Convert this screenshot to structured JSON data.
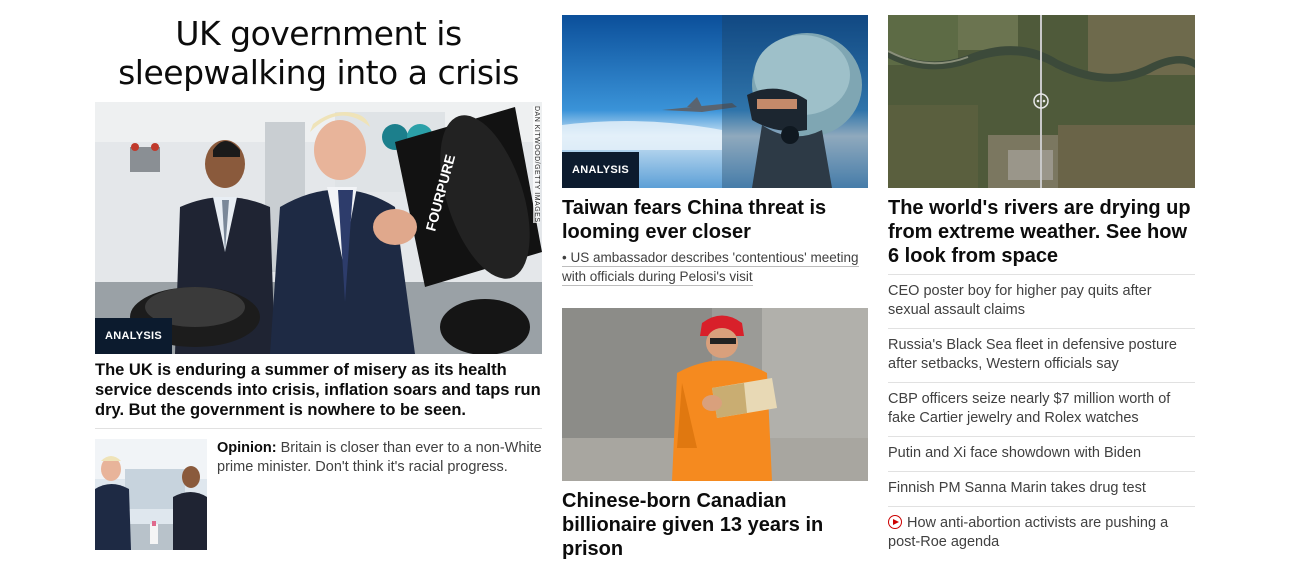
{
  "lead": {
    "headline": "UK government is sleepwalking into a crisis",
    "badge": "ANALYSIS",
    "photo_credit": "DAN KITWOOD/GETTY IMAGES",
    "summary": "The UK is enduring a summer of misery as its health service descends into crisis, inflation soars and taps run dry. But the government is nowhere to be seen.",
    "opinion_label": "Opinion:",
    "opinion_text": " Britain is closer than ever to a non-White prime minister. Don't think it's racial progress."
  },
  "taiwan": {
    "badge": "ANALYSIS",
    "headline": "Taiwan fears China threat is looming ever closer",
    "bullet": "• US ambassador describes 'contentious' meeting with officials during Pelosi's visit"
  },
  "canadian": {
    "headline": "Chinese-born Canadian billionaire given 13 years in prison"
  },
  "rivers": {
    "headline": "The world's rivers are drying up from extreme weather. See how 6 look from space"
  },
  "list": [
    {
      "text": "CEO poster boy for higher pay quits after sexual assault claims",
      "video": false
    },
    {
      "text": "Russia's Black Sea fleet in defensive posture after setbacks, Western officials say",
      "video": false
    },
    {
      "text": "CBP officers seize nearly $7 million worth of fake Cartier jewelry and Rolex watches",
      "video": false
    },
    {
      "text": "Putin and Xi face showdown with Biden",
      "video": false
    },
    {
      "text": "Finnish PM Sanna Marin takes drug test",
      "video": false
    },
    {
      "text": "How anti-abortion activists are pushing a post-Roe agenda",
      "video": true
    }
  ],
  "colors": {
    "badge_bg": "#0c1b2e",
    "video_icon": "#cc0000"
  },
  "icons": {
    "video": "play-circle-icon"
  }
}
